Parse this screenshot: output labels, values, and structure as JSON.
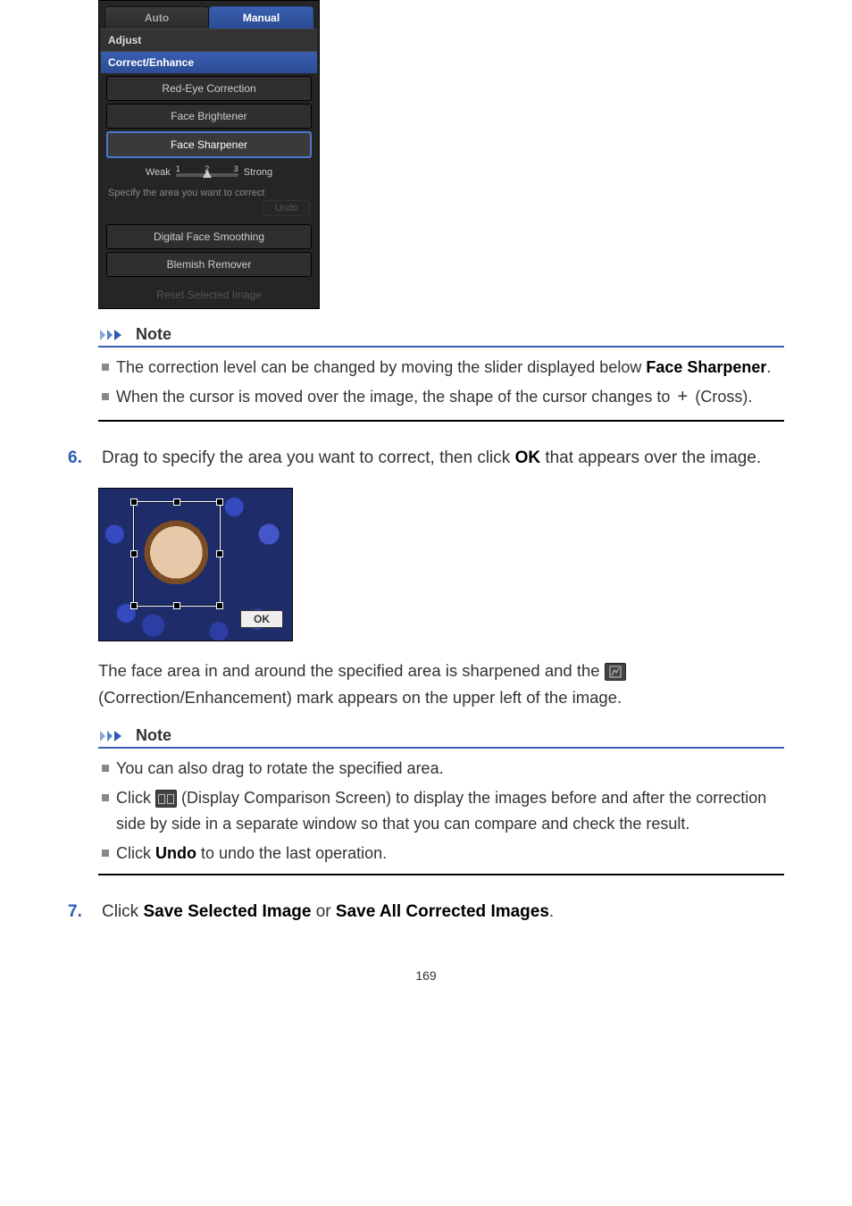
{
  "panel": {
    "tabs": {
      "auto": "Auto",
      "manual": "Manual"
    },
    "subtabs": {
      "adjust": "Adjust",
      "correct": "Correct/Enhance"
    },
    "options": {
      "redeye": "Red-Eye Correction",
      "brightener": "Face Brightener",
      "sharpener": "Face Sharpener",
      "smoothing": "Digital Face Smoothing",
      "blemish": "Blemish Remover"
    },
    "slider": {
      "weak": "Weak",
      "strong": "Strong",
      "ticks": [
        "1",
        "2",
        "3"
      ]
    },
    "hint": "Specify the area you want to correct",
    "undo": "Undo",
    "reset": "Reset Selected Image"
  },
  "notes": {
    "label": "Note",
    "first": {
      "item1_pre": "The correction level can be changed by moving the slider displayed below ",
      "item1_bold": "Face Sharpener",
      "item1_post": ".",
      "item2_pre": "When the cursor is moved over the image, the shape of the cursor changes to ",
      "item2_post": " (Cross)."
    },
    "second": {
      "item1": "You can also drag to rotate the specified area.",
      "item2_pre": "Click ",
      "item2_post": " (Display Comparison Screen) to display the images before and after the correction side by side in a separate window so that you can compare and check the result.",
      "item3_pre": "Click ",
      "item3_bold": "Undo",
      "item3_post": " to undo the last operation."
    }
  },
  "steps": {
    "s6": {
      "num": "6.",
      "text_pre": "Drag to specify the area you want to correct, then click ",
      "text_bold": "OK",
      "text_post": " that appears over the image."
    },
    "s7": {
      "num": "7.",
      "text_pre": "Click ",
      "bold1": "Save Selected Image",
      "mid": " or ",
      "bold2": "Save All Corrected Images",
      "post": "."
    }
  },
  "body": {
    "after_photo_pre": "The face area in and around the specified area is sharpened and the ",
    "after_photo_post": " (Correction/Enhancement) mark appears on the upper left of the image."
  },
  "photo": {
    "ok": "OK"
  },
  "plus": "+",
  "page_number": "169"
}
